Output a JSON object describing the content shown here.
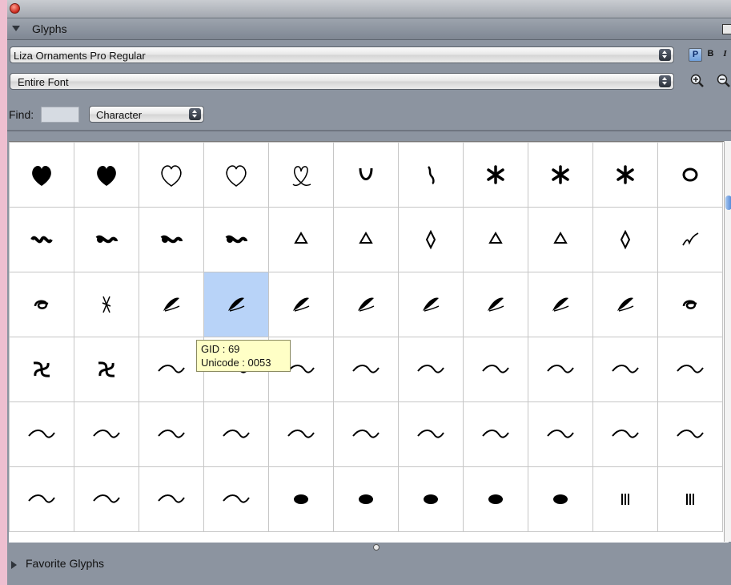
{
  "panel": {
    "title": "Glyphs"
  },
  "font_select": {
    "value": "Liza Ornaments Pro Regular"
  },
  "style_buttons": [
    {
      "label": "P"
    },
    {
      "label": "B"
    },
    {
      "label": "I"
    }
  ],
  "scope_select": {
    "value": "Entire Font"
  },
  "find": {
    "label": "Find:",
    "value": "",
    "mode": "Character"
  },
  "grid": {
    "columns": 11,
    "visible_rows": 6,
    "selected_index": 25,
    "glyph_icons": [
      "heart-icon",
      "heart-icon",
      "heart-outline-icon",
      "heart-outline-icon",
      "ribbon-heart-icon",
      "horseshoe-icon",
      "flourish-icon",
      "asterisk-flower-icon",
      "asterisk-flower-icon",
      "asterisk-flower-icon",
      "ring-icon",
      "scroll-wave-icon",
      "swirl-icon",
      "swirl-icon",
      "swirl-icon",
      "drop-icon",
      "drop-icon",
      "diamond-icon",
      "drop-icon",
      "drop-icon",
      "diamond-icon",
      "checkmark-icon",
      "curl-icon",
      "cross-icon",
      "leaf-icon",
      "leaf-icon",
      "leaf-icon",
      "leaf-icon",
      "leaf-icon",
      "leaf-icon",
      "leaf-icon",
      "leaf-icon",
      "curl-icon",
      "knot-icon",
      "knot-icon",
      "swash-icon",
      "swash-icon",
      "swash-icon",
      "swash-icon",
      "swash-icon",
      "swash-icon",
      "swash-icon",
      "swash-icon",
      "swash-icon",
      "swash-icon",
      "swash-icon",
      "swash-icon",
      "swash-icon",
      "swash-icon",
      "swash-icon",
      "swash-icon",
      "swash-icon",
      "swash-icon",
      "swash-icon",
      "swash-icon",
      "swash-icon",
      "swash-icon",
      "swash-icon",
      "swash-icon",
      "blot-icon",
      "blot-icon",
      "blot-icon",
      "blot-icon",
      "blot-icon",
      "bar-icon",
      "bar-icon"
    ]
  },
  "tooltip": {
    "gid": "GID : 69",
    "unicode": "Unicode : 0053"
  },
  "favorites": {
    "label": "Favorite Glyphs"
  },
  "colors": {
    "selection": "#b8d3f8",
    "panel_bg": "#8c94a0",
    "desktop": "#eebfd0",
    "tooltip_bg": "#ffffc6"
  }
}
